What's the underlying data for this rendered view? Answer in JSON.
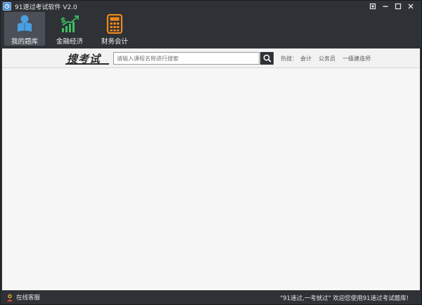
{
  "window": {
    "title": "91速过考试软件 V2.0"
  },
  "toolbar": {
    "items": [
      {
        "label": "我的题库",
        "icon": "user-book-icon",
        "active": true
      },
      {
        "label": "金融经济",
        "icon": "finance-chart-icon",
        "active": false
      },
      {
        "label": "财务会计",
        "icon": "calculator-icon",
        "active": false
      }
    ]
  },
  "search": {
    "brand": "搜考试",
    "placeholder": "请输入课程名称进行搜索",
    "hot_label": "热搜：",
    "hot_links": [
      "会计",
      "公务员",
      "一级建造师"
    ]
  },
  "status": {
    "customer_service": "在线客服",
    "welcome": "\"91速过,一考就过\" 欢迎您使用91速过考试题库!"
  },
  "colors": {
    "chrome": "#2e3136",
    "active_tool": "#4b5058",
    "user_icon": "#4a9fe0",
    "finance_icon": "#3cbf5f",
    "calculator_icon": "#f08a1a",
    "content_bg": "#f6f6f6"
  }
}
